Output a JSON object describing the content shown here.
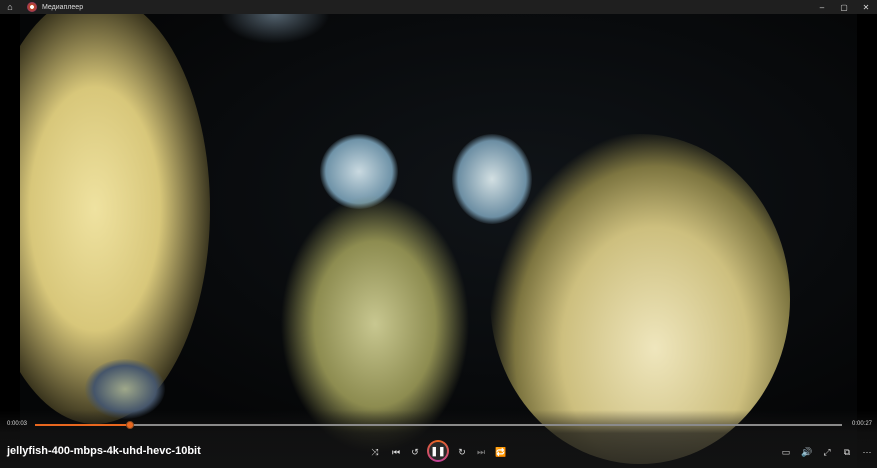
{
  "window": {
    "title": "Медиаплеер",
    "home_icon": "⌂",
    "minimize": "–",
    "maximize": "▢",
    "close": "✕"
  },
  "player": {
    "file_name": "jellyfish-400-mbps-4k-uhd-hevc-10bit",
    "elapsed": "0:00:03",
    "total": "0:00:27",
    "progress": 0.118,
    "buttons": {
      "shuffle": "⤨",
      "previous": "⏮",
      "rewind": "↺",
      "pause": "❚❚",
      "forward": "↻",
      "next": "⏭",
      "repeat": "🔁",
      "miniplayer": "▭",
      "volume": "🔊",
      "fullscreen": "⤢",
      "cast": "⧉",
      "more": "⋯"
    },
    "accent": "#e8671f"
  }
}
